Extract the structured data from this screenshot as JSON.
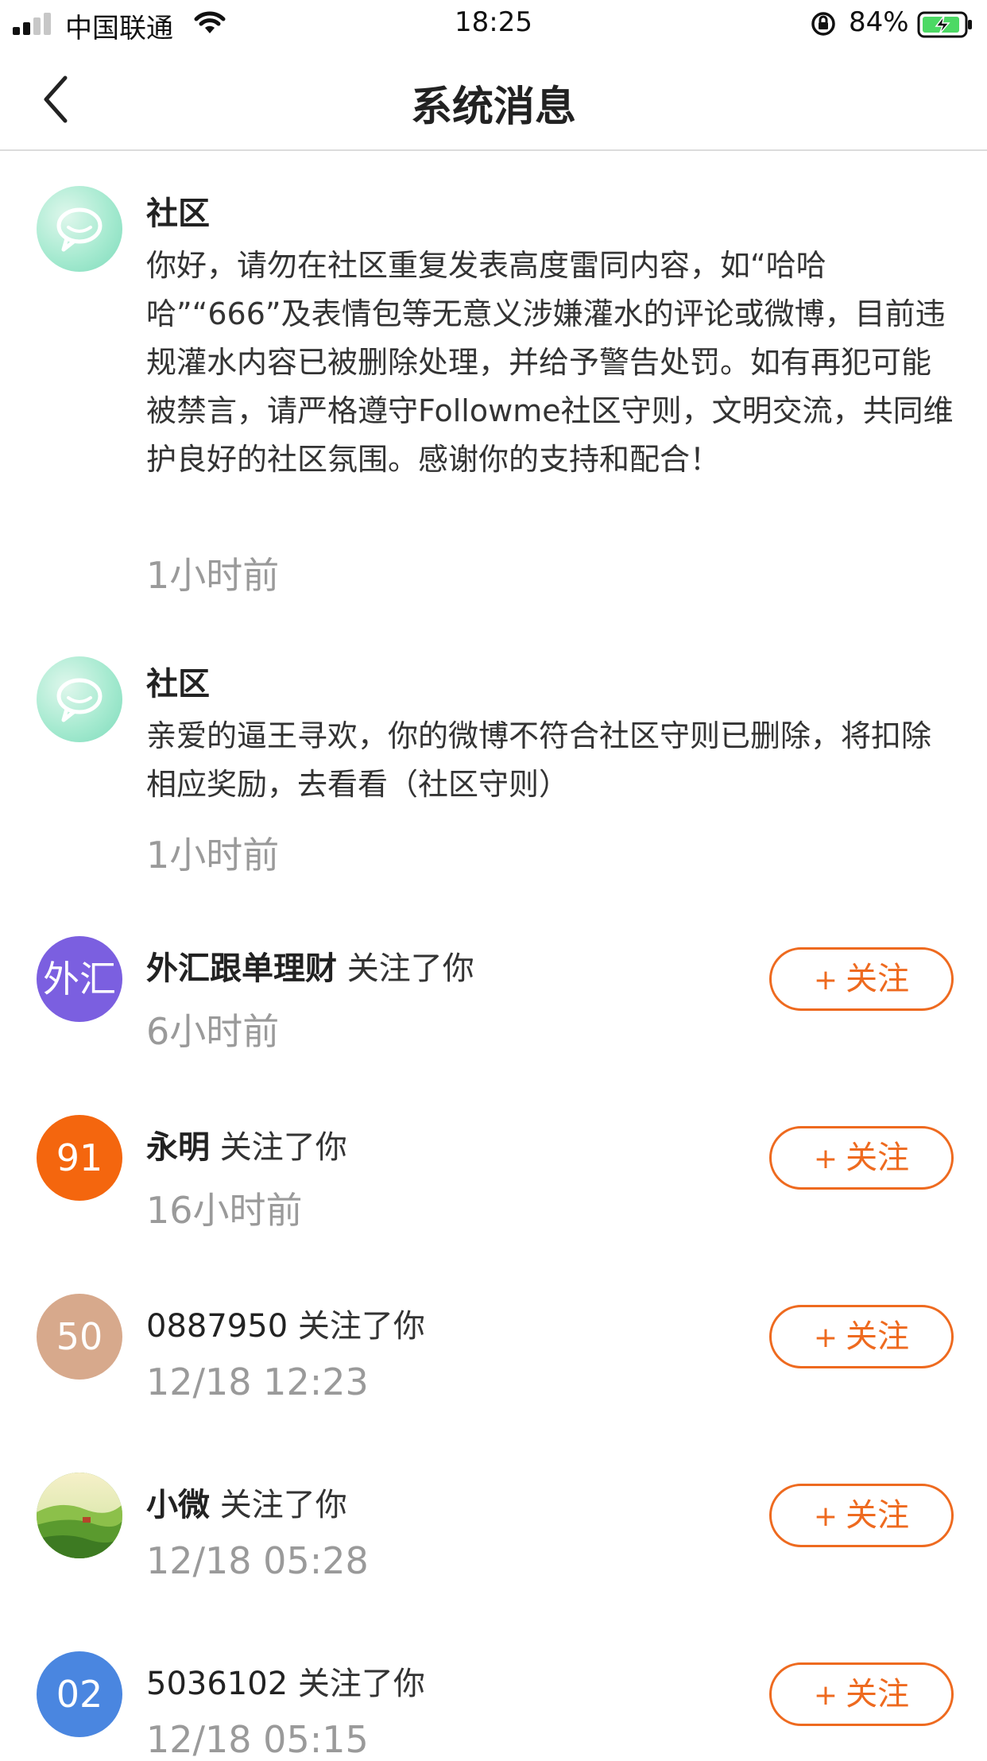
{
  "status_bar": {
    "carrier": "中国联通",
    "time": "18:25",
    "battery": "84%"
  },
  "nav": {
    "title": "系统消息"
  },
  "system_messages": [
    {
      "title": "社区",
      "body": "你好，请勿在社区重复发表高度雷同内容，如“哈哈哈”“666”及表情包等无意义涉嫌灌水的评论或微博，目前违规灌水内容已被删除处理，并给予警告处罚。如有再犯可能被禁言，请严格遵守Followme社区守则，文明交流，共同维护良好的社区氛围。感谢你的支持和配合！",
      "time": "1小时前"
    },
    {
      "title": "社区",
      "body": "亲爱的逼王寻欢，你的微博不符合社区守则已删除，将扣除相应奖励，去看看（社区守则）",
      "time": "1小时前"
    }
  ],
  "follow_action_text": "关注了你",
  "follow_button_label": "关注",
  "follow_button_plus": "+",
  "followers": [
    {
      "avatar_text": "外汇",
      "avatar_color": "#7b5fe0",
      "name": "外汇跟单理财",
      "time": "6小时前"
    },
    {
      "avatar_text": "91",
      "avatar_color": "#f4660e",
      "name": "永明",
      "time": "16小时前"
    },
    {
      "avatar_text": "50",
      "avatar_color": "#d7a98c",
      "name": "0887950",
      "time": "12/18 12:23"
    },
    {
      "avatar_text": "",
      "avatar_color": "#5a9a3a",
      "name": "小微",
      "time": "12/18 05:28"
    },
    {
      "avatar_text": "02",
      "avatar_color": "#4a86e0",
      "name": "5036102",
      "time": "12/18 05:15"
    }
  ],
  "colors": {
    "accent": "#ee6a1f",
    "time_gray": "#9a9a9a"
  }
}
